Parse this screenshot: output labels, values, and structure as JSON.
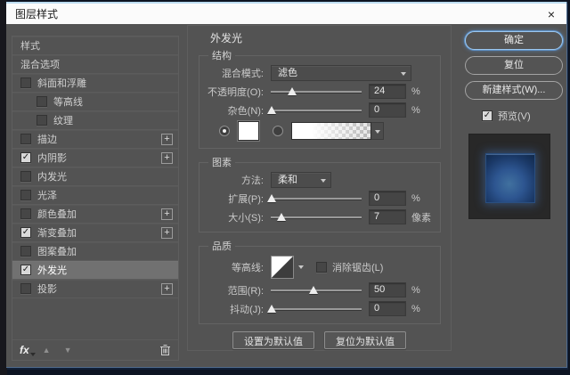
{
  "window": {
    "title": "图层样式"
  },
  "icons": {
    "close": "×",
    "check": "✓",
    "plus": "+",
    "up_arrow": "▲",
    "down_arrow": "▼"
  },
  "sidebar": {
    "items": [
      {
        "label": "样式",
        "type": "plain"
      },
      {
        "label": "混合选项",
        "type": "plain"
      },
      {
        "label": "斜面和浮雕",
        "checked": false
      },
      {
        "label": "等高线",
        "checked": false,
        "indent": true
      },
      {
        "label": "纹理",
        "checked": false,
        "indent": true
      },
      {
        "label": "描边",
        "checked": false,
        "plus": true
      },
      {
        "label": "内阴影",
        "checked": true,
        "plus": true
      },
      {
        "label": "内发光",
        "checked": false
      },
      {
        "label": "光泽",
        "checked": false
      },
      {
        "label": "颜色叠加",
        "checked": false,
        "plus": true
      },
      {
        "label": "渐变叠加",
        "checked": true,
        "plus": true
      },
      {
        "label": "图案叠加",
        "checked": false
      },
      {
        "label": "外发光",
        "checked": true,
        "selected": true
      },
      {
        "label": "投影",
        "checked": false,
        "plus": true
      }
    ],
    "footer": {
      "fx_label": "fx"
    }
  },
  "panel": {
    "title": "外发光",
    "structure": {
      "legend": "结构",
      "blend_mode_label": "混合模式:",
      "blend_mode_value": "滤色",
      "opacity_label": "不透明度(O):",
      "opacity_value": "24",
      "opacity_unit": "%",
      "opacity_thumb_pct": 24,
      "noise_label": "杂色(N):",
      "noise_value": "0",
      "noise_unit": "%",
      "noise_thumb_pct": 1,
      "color_mode": "solid-color-selected"
    },
    "elements": {
      "legend": "图素",
      "technique_label": "方法:",
      "technique_value": "柔和",
      "spread_label": "扩展(P):",
      "spread_value": "0",
      "spread_unit": "%",
      "spread_thumb_pct": 1,
      "size_label": "大小(S):",
      "size_value": "7",
      "size_unit": "像素",
      "size_thumb_pct": 12
    },
    "quality": {
      "legend": "品质",
      "contour_label": "等高线:",
      "antialias_label": "消除锯齿(L)",
      "antialias_checked": false,
      "range_label": "范围(R):",
      "range_value": "50",
      "range_unit": "%",
      "range_thumb_pct": 47,
      "jitter_label": "抖动(J):",
      "jitter_value": "0",
      "jitter_unit": "%",
      "jitter_thumb_pct": 1
    },
    "buttons": {
      "make_default": "设置为默认值",
      "reset_default": "复位为默认值"
    }
  },
  "actions": {
    "ok": "确定",
    "reset": "复位",
    "new_style": "新建样式(W)...",
    "preview_label": "预览(V)",
    "preview_checked": true
  },
  "colors": {
    "dialog_bg": "#535353",
    "titlebar_bg": "#fbfbfb",
    "focus_ring": "#5d8fc4",
    "glow_preview_blue": "#2d5590"
  }
}
